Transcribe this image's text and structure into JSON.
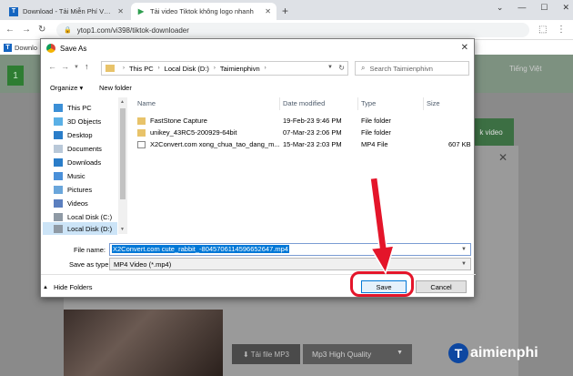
{
  "browser": {
    "tabs": [
      {
        "label": "Download - Tải Miễn Phí VN - Ph...",
        "icon": "T",
        "active": false
      },
      {
        "label": "Tải video Tiktok không logo nhanh",
        "icon": "▶",
        "active": true
      }
    ],
    "new_tab": "+",
    "window_controls": [
      "⌄",
      "—",
      "☐",
      "✕"
    ],
    "url": "ytop1.com/vi398/tiktok-downloader",
    "bookmark_label": "Downlo"
  },
  "page": {
    "language": "Tiếng Việt",
    "green_button": "k video",
    "download_mp3": "⬇ Tải file MP3",
    "quality_select": "Mp3 High Quality",
    "logo_text": "aimienphi",
    "logo_mark": "T"
  },
  "dialog": {
    "title": "Save As",
    "breadcrumb": [
      "This PC",
      "Local Disk (D:)",
      "Taimienphivn"
    ],
    "search_placeholder": "Search Taimienphivn",
    "organize": "Organize ▾",
    "new_folder": "New folder",
    "tree": [
      {
        "label": "This PC",
        "icon": "pc-icon"
      },
      {
        "label": "3D Objects",
        "icon": "3d-objects-icon"
      },
      {
        "label": "Desktop",
        "icon": "desktop-icon"
      },
      {
        "label": "Documents",
        "icon": "documents-icon"
      },
      {
        "label": "Downloads",
        "icon": "downloads-icon"
      },
      {
        "label": "Music",
        "icon": "music-icon"
      },
      {
        "label": "Pictures",
        "icon": "pictures-icon"
      },
      {
        "label": "Videos",
        "icon": "videos-icon"
      },
      {
        "label": "Local Disk (C:)",
        "icon": "drive-icon"
      },
      {
        "label": "Local Disk (D:)",
        "icon": "drive-icon",
        "selected": true
      }
    ],
    "columns": {
      "name": "Name",
      "date": "Date modified",
      "type": "Type",
      "size": "Size"
    },
    "files": [
      {
        "name": "FastStone Capture",
        "date": "19-Feb-23 9:46 PM",
        "type": "File folder",
        "size": "",
        "icon": "folder-icon"
      },
      {
        "name": "unikey_43RC5-200929-64bit",
        "date": "07-Mar-23 2:06 PM",
        "type": "File folder",
        "size": "",
        "icon": "folder-icon"
      },
      {
        "name": "X2Convert.com xong_chua_tao_dang_m...",
        "date": "15-Mar-23 2:03 PM",
        "type": "MP4 File",
        "size": "607 KB",
        "icon": "video-file-icon"
      }
    ],
    "file_name_label": "File name:",
    "file_name_value": "X2Convert.com cute_rabbit_-8045706114596652647.mp4",
    "save_type_label": "Save as type:",
    "save_type_value": "MP4 Video (*.mp4)",
    "hide_folders": "Hide Folders",
    "save": "Save",
    "cancel": "Cancel"
  },
  "colors": {
    "highlight": "#e4152a",
    "accent": "#0078d7"
  }
}
